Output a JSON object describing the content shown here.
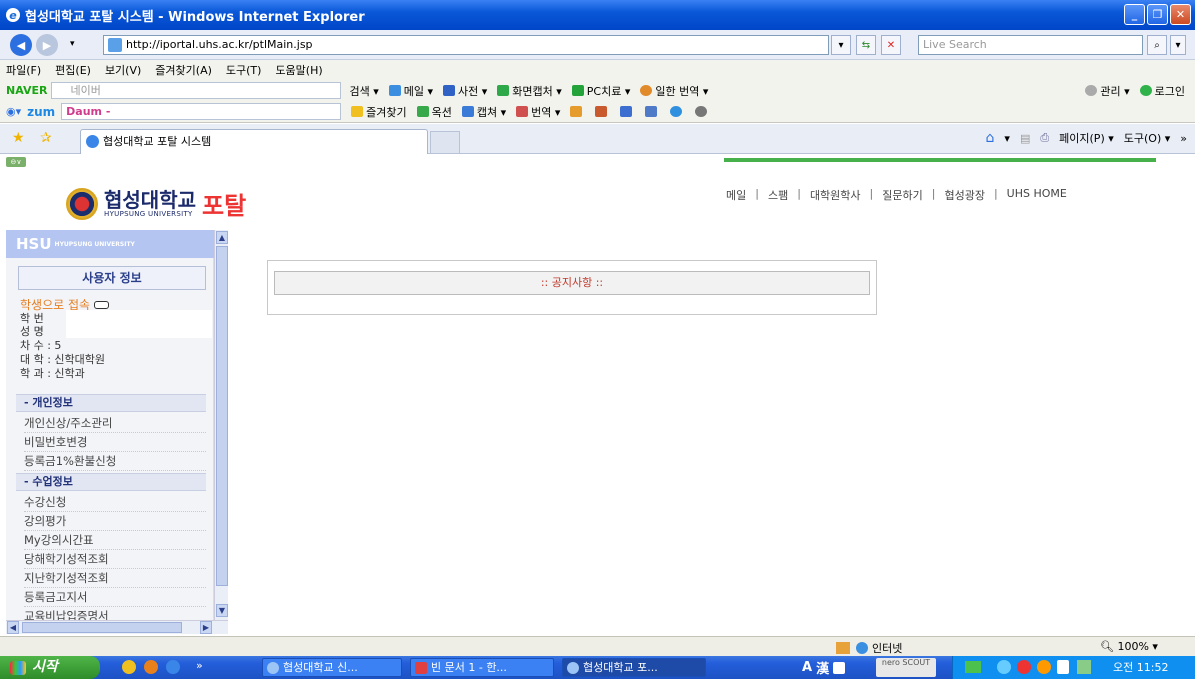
{
  "window": {
    "title": "협성대학교 포탈 시스템 - Windows Internet Explorer"
  },
  "address": {
    "url": "http://iportal.uhs.ac.kr/ptlMain.jsp",
    "search_placeholder": "Live Search"
  },
  "menu": [
    "파일(F)",
    "편집(E)",
    "보기(V)",
    "즐겨찾기(A)",
    "도구(T)",
    "도움말(H)"
  ],
  "naver_bar": {
    "logo": "NAVER",
    "placeholder": "네이버",
    "items": [
      "검색 ▾",
      "메일 ▾",
      "사전 ▾",
      "화면캡처 ▾",
      "PC치료 ▾",
      "일한 번역 ▾"
    ],
    "right": [
      "관리 ▾",
      "로그인"
    ]
  },
  "zum_bar": {
    "logo": "zum",
    "box_text": "Daum -",
    "items": [
      "즐겨찾기",
      "옥션",
      "캡쳐 ▾",
      "번역 ▾"
    ]
  },
  "tab": {
    "label": "협성대학교 포탈 시스템",
    "right": [
      "▾",
      "페이지(P) ▾",
      "도구(O) ▾"
    ]
  },
  "header": {
    "logo_kr": "협성대학교",
    "logo_en": "HYUPSUNG UNIVERSITY",
    "logo_portal": "포탈",
    "nav": [
      "메일",
      "스팸",
      "대학원학사",
      "질문하기",
      "협성광장",
      "UHS HOME"
    ]
  },
  "sidebar": {
    "banner": "HSU",
    "banner_sub": "HYUPSUNG UNIVERSITY",
    "user_title": "사용자 정보",
    "login_as": "학생으로 접속",
    "info": [
      "학   번",
      "성   명",
      "차   수 : 5",
      "대   학 : 신학대학원",
      "학   과 : 신학과"
    ],
    "section1": "- 개인정보",
    "section1_items": [
      "개인신상/주소관리",
      "비밀번호변경",
      "등록금1%환불신청"
    ],
    "section2": "- 수업정보",
    "section2_items": [
      "수강신청",
      "강의평가",
      "My강의시간표",
      "당해학기성적조회",
      "지난학기성적조회",
      "등록금고지서",
      "교육비납입증명서"
    ]
  },
  "notice": {
    "title": ":: 공지사항 ::"
  },
  "status": {
    "zone": "인터넷",
    "zoom": "100%"
  },
  "taskbar": {
    "start": "시작",
    "tasks": [
      "협성대학교 신...",
      "빈 문서 1 - 한...",
      "협성대학교 포..."
    ],
    "clock": "오전 11:52",
    "ime": [
      "A",
      "漢"
    ],
    "nero": "nero SCOUT"
  }
}
